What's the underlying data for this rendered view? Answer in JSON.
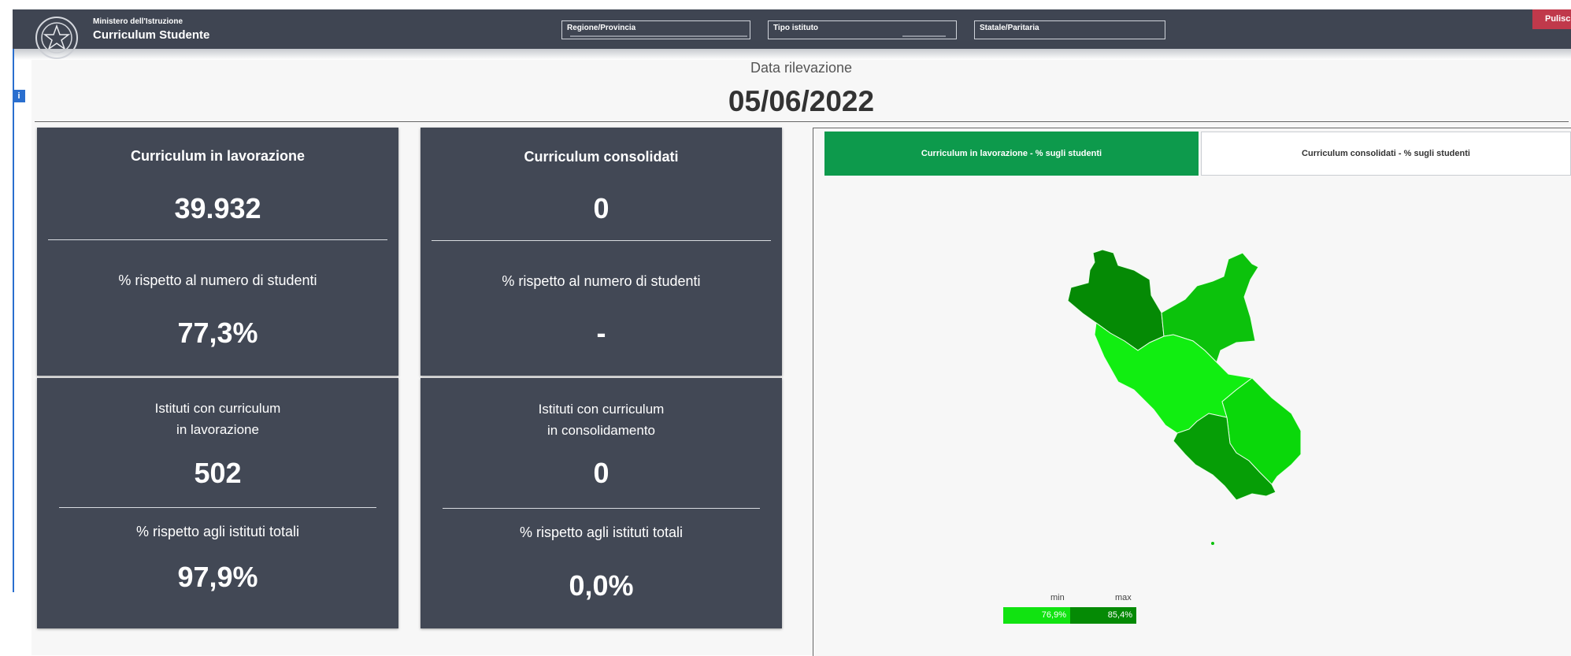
{
  "header": {
    "ministry": "Ministero dell'Istruzione",
    "app_title": "Curriculum Studente",
    "filters": [
      "Regione/Provincia",
      "Tipo istituto",
      "Statale/Paritaria"
    ],
    "clear_button": "Pulisci Filt",
    "info_badge": "i"
  },
  "date": {
    "label": "Data rilevazione",
    "value": "05/06/2022"
  },
  "cards": {
    "lavorazione": {
      "title": "Curriculum in lavorazione",
      "value": "39.932",
      "pct_label": "% rispetto al numero di studenti",
      "pct_value": "77,3%"
    },
    "consolidati": {
      "title": "Curriculum consolidati",
      "value": "0",
      "pct_label": "% rispetto al numero di studenti",
      "pct_value": "-"
    },
    "istituti_lavorazione": {
      "title_line1": "Istituti con curriculum",
      "title_line2": "in lavorazione",
      "value": "502",
      "pct_label": "% rispetto agli istituti totali",
      "pct_value": "97,9%"
    },
    "istituti_consolidamento": {
      "title_line1": "Istituti con curriculum",
      "title_line2": "in consolidamento",
      "value": "0",
      "pct_label": "% rispetto agli istituti totali",
      "pct_value": "0,0%"
    }
  },
  "map": {
    "tabs": [
      "Curriculum in lavorazione - % sugli studenti",
      "Curriculum consolidati - % sugli studenti"
    ],
    "legend": {
      "min_label": "min",
      "max_label": "max",
      "min_value": "76,9%",
      "max_value": "85,4%"
    },
    "colors": {
      "viterbo": "#058a05",
      "rieti": "#0cc20c",
      "roma": "#11ee11",
      "frosinone": "#0ad80a",
      "latina": "#069e06",
      "min": "#11e311",
      "max": "#058a05"
    }
  }
}
